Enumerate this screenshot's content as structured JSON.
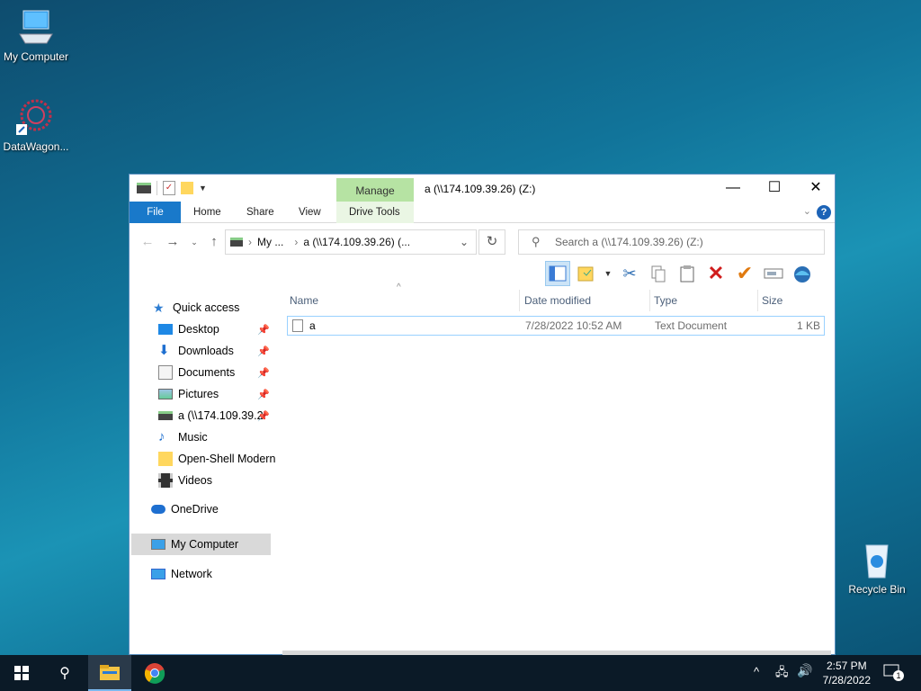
{
  "desktop": {
    "icons": [
      {
        "label": "My Computer"
      },
      {
        "label": "DataWagon..."
      },
      {
        "label": "Recycle Bin"
      }
    ]
  },
  "window": {
    "title": "a (\\\\174.109.39.26) (Z:)",
    "contextual_tab_group": "Manage",
    "ribbon_tabs": [
      "File",
      "Home",
      "Share",
      "View",
      "Drive Tools"
    ],
    "address": {
      "crumb1": "My ...",
      "crumb2": "a (\\\\174.109.39.26) (..."
    },
    "search_placeholder": "Search a (\\\\174.109.39.26) (Z:)",
    "nav": {
      "quick_access": "Quick access",
      "items": [
        "Desktop",
        "Downloads",
        "Documents",
        "Pictures",
        "a (\\\\174.109.39.2",
        "Music",
        "Open-Shell Modern",
        "Videos"
      ],
      "onedrive": "OneDrive",
      "my_computer": "My Computer",
      "network": "Network"
    },
    "columns": {
      "name": "Name",
      "date": "Date modified",
      "type": "Type",
      "size": "Size"
    },
    "files": [
      {
        "name": "a",
        "date": "7/28/2022 10:52 AM",
        "type": "Text Document",
        "size": "1 KB"
      }
    ]
  },
  "taskbar": {
    "time": "2:57 PM",
    "date": "7/28/2022",
    "notification_count": "1"
  }
}
